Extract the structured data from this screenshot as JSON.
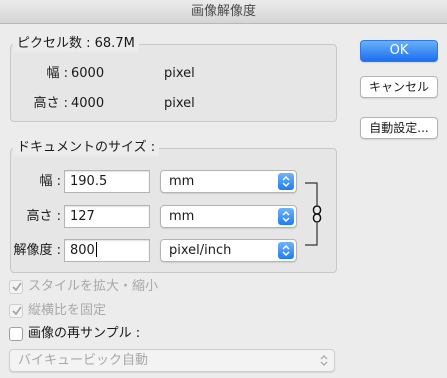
{
  "window": {
    "title": "画像解像度"
  },
  "pixel_dimensions": {
    "legend": "ピクセル数 : 68.7M",
    "width": {
      "label": "幅 :",
      "value": "6000",
      "unit": "pixel"
    },
    "height": {
      "label": "高さ :",
      "value": "4000",
      "unit": "pixel"
    }
  },
  "document_size": {
    "legend": "ドキュメントのサイズ :",
    "width": {
      "label": "幅 :",
      "value": "190.5",
      "unit": "mm"
    },
    "height": {
      "label": "高さ :",
      "value": "127",
      "unit": "mm"
    },
    "resolution": {
      "label": "解像度 :",
      "value": "800",
      "unit": "pixel/inch"
    },
    "link_icon": "chain-link-icon"
  },
  "options": {
    "scale_styles": {
      "label": "スタイルを拡大・縮小",
      "checked": true,
      "enabled": false
    },
    "constrain_proportions": {
      "label": "縦横比を固定",
      "checked": true,
      "enabled": false
    },
    "resample": {
      "label": "画像の再サンプル :",
      "checked": false,
      "enabled": true
    },
    "resample_method": {
      "value": "バイキュービック自動",
      "enabled": false
    }
  },
  "buttons": {
    "ok": "OK",
    "cancel": "キャンセル",
    "auto": "自動設定..."
  },
  "colors": {
    "accent": "#1b6ff0",
    "window_bg": "#ececec"
  }
}
